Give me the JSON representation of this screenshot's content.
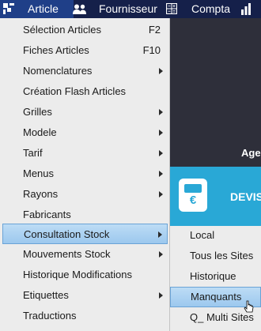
{
  "menubar": {
    "items": [
      {
        "label": "Article",
        "icon": "article-logo-icon"
      },
      {
        "label": "Fournisseur",
        "icon": "users-icon"
      },
      {
        "label": "Compta",
        "icon": "calculator-icon"
      },
      {
        "label": "",
        "icon": "bar-chart-icon"
      }
    ]
  },
  "menu": {
    "items": [
      {
        "label": "Sélection Articles",
        "shortcut": "F2"
      },
      {
        "label": "Fiches Articles",
        "shortcut": "F10"
      },
      {
        "label": "Nomenclatures",
        "submenu": true
      },
      {
        "label": "Création Flash Articles"
      },
      {
        "label": "Grilles",
        "submenu": true
      },
      {
        "label": "Modele",
        "submenu": true
      },
      {
        "label": "Tarif",
        "submenu": true
      },
      {
        "label": "Menus",
        "submenu": true
      },
      {
        "label": "Rayons",
        "submenu": true
      },
      {
        "label": "Fabricants"
      },
      {
        "label": "Consultation Stock",
        "submenu": true,
        "active": true
      },
      {
        "label": "Mouvements Stock",
        "submenu": true
      },
      {
        "label": "Historique Modifications"
      },
      {
        "label": "Etiquettes",
        "submenu": true
      },
      {
        "label": "Traductions"
      }
    ]
  },
  "submenu": {
    "items": [
      {
        "label": "Local"
      },
      {
        "label": "Tous les Sites"
      },
      {
        "label": "Historique"
      },
      {
        "label": "Manquants",
        "active": true
      },
      {
        "label": "Q_ Multi Sites"
      }
    ]
  },
  "background": {
    "label": "Age",
    "tile_text": "DEVIS",
    "tile_icon": "euro-card-icon",
    "tile_symbol": "€"
  },
  "colors": {
    "menubar": "#15204a",
    "menubar_active": "#1f3f88",
    "menu_bg": "#ececec",
    "highlight": "#9cc8ee",
    "tile": "#29a8d6",
    "dark_bg": "#2c2f3a"
  }
}
